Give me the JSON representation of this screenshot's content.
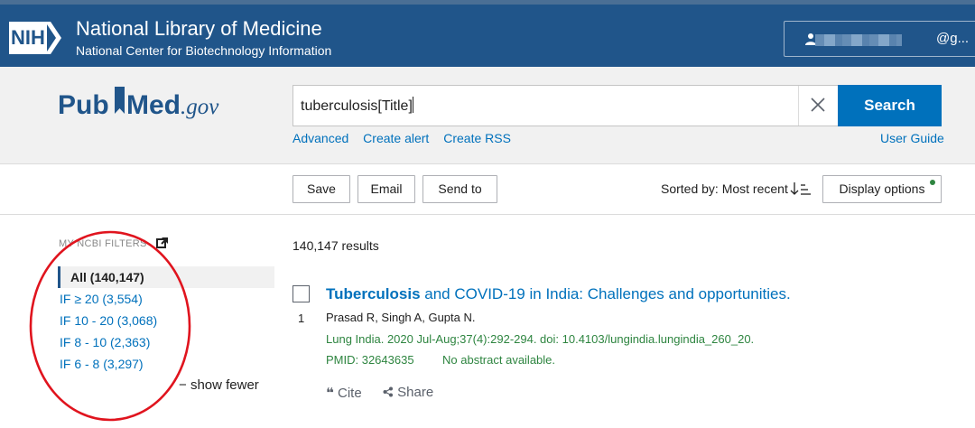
{
  "nih": {
    "logo_text": "NIH",
    "title": "National Library of Medicine",
    "subtitle": "National Center for Biotechnology Information",
    "account_email": "@g..."
  },
  "logo": {
    "pub": "Pub",
    "med": "Med",
    "gov": ".gov"
  },
  "search": {
    "query": "tuberculosis[Title]",
    "button": "Search"
  },
  "links": {
    "advanced": "Advanced",
    "create_alert": "Create alert",
    "create_rss": "Create RSS",
    "user_guide": "User Guide"
  },
  "actions": {
    "save": "Save",
    "email": "Email",
    "send_to": "Send to",
    "sorted_by": "Sorted by: Most recent",
    "display_options": "Display options"
  },
  "filters": {
    "heading": "MY NCBI FILTERS",
    "items": [
      {
        "label": "All (140,147)"
      },
      {
        "label": "IF ≥ 20 (3,554)"
      },
      {
        "label": "IF 10 - 20 (3,068)"
      },
      {
        "label": "IF 8 - 10 (2,363)"
      },
      {
        "label": "IF 6 - 8 (3,297)"
      }
    ],
    "show_fewer": "show fewer"
  },
  "results": {
    "count": "140,147 results",
    "items": [
      {
        "number": "1",
        "title_highlight": "Tuberculosis",
        "title_rest": " and COVID-19 in India: Challenges and opportunities.",
        "authors": "Prasad R, Singh A, Gupta N.",
        "journal": "Lung India. 2020 Jul-Aug;37(4):292-294. doi: 10.4103/lungindia.lungindia_260_20.",
        "pmid": "PMID: 32643635",
        "abstract_note": "No abstract available.",
        "cite": "Cite",
        "share": "Share"
      }
    ]
  },
  "colors": {
    "nih_blue": "#20558a",
    "link_blue": "#0071bc",
    "citation_green": "#2e8540",
    "annotation_red": "#e0141e"
  }
}
